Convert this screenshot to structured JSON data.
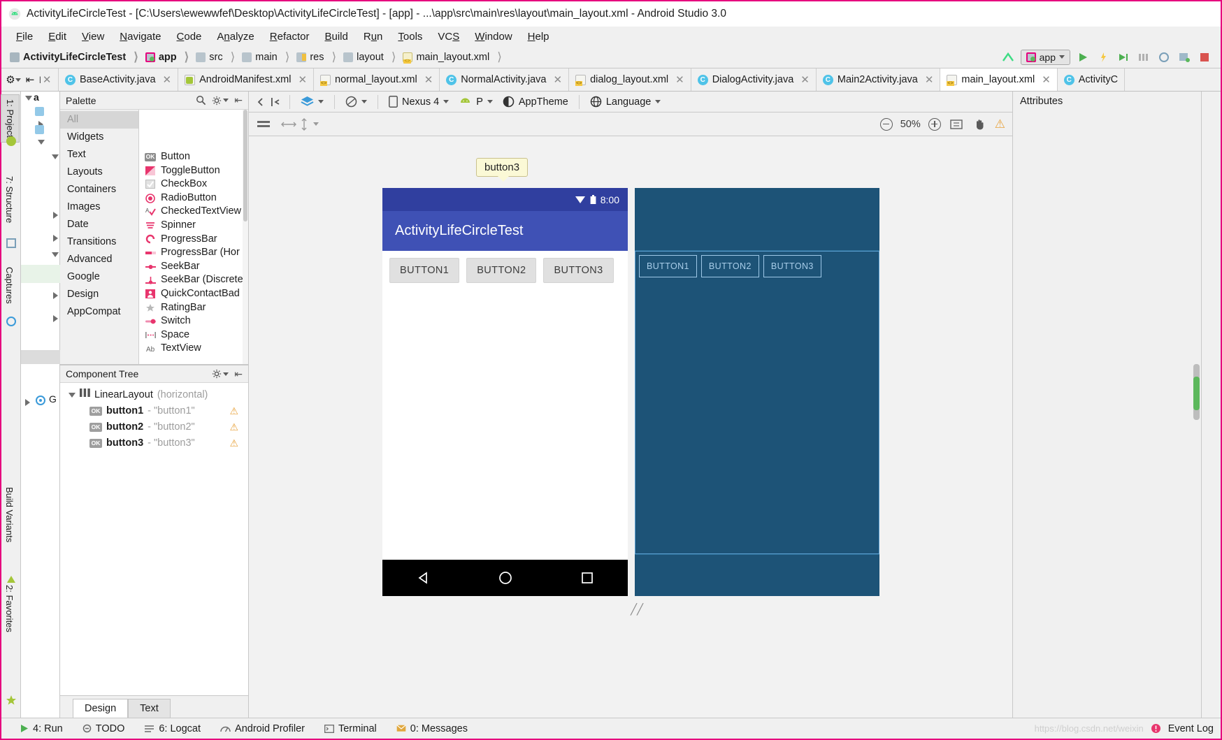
{
  "window": {
    "title": "ActivityLifeCircleTest - [C:\\Users\\ewewwfef\\Desktop\\ActivityLifeCircleTest] - [app] - ...\\app\\src\\main\\res\\layout\\main_layout.xml - Android Studio 3.0",
    "logo_icon": "android-studio-icon"
  },
  "menubar": {
    "items": [
      {
        "label": "File"
      },
      {
        "label": "Edit"
      },
      {
        "label": "View"
      },
      {
        "label": "Navigate"
      },
      {
        "label": "Code"
      },
      {
        "label": "Analyze"
      },
      {
        "label": "Refactor"
      },
      {
        "label": "Build"
      },
      {
        "label": "Run"
      },
      {
        "label": "Tools"
      },
      {
        "label": "VCS"
      },
      {
        "label": "Window"
      },
      {
        "label": "Help"
      }
    ]
  },
  "breadcrumb": {
    "items": [
      {
        "label": "ActivityLifeCircleTest",
        "icon": "project-folder-icon"
      },
      {
        "label": "app",
        "icon": "module-folder-icon"
      },
      {
        "label": "src",
        "icon": "folder-icon"
      },
      {
        "label": "main",
        "icon": "folder-icon"
      },
      {
        "label": "res",
        "icon": "res-folder-icon"
      },
      {
        "label": "layout",
        "icon": "folder-icon"
      },
      {
        "label": "main_layout.xml",
        "icon": "xml-file-icon"
      }
    ],
    "run_config": "app",
    "toolbar_icons": [
      "branch-icon",
      "run-icon",
      "debug-icon",
      "attach-debugger-icon",
      "coverage-icon",
      "profiler-icon",
      "avd-manager-icon",
      "stop-icon"
    ]
  },
  "editor_tabs": [
    {
      "label": "BaseActivity.java",
      "icon": "java-class-icon",
      "active": false
    },
    {
      "label": "AndroidManifest.xml",
      "icon": "manifest-icon",
      "active": false
    },
    {
      "label": "normal_layout.xml",
      "icon": "xml-layout-icon",
      "active": false
    },
    {
      "label": "NormalActivity.java",
      "icon": "java-class-icon",
      "active": false
    },
    {
      "label": "dialog_layout.xml",
      "icon": "xml-layout-icon",
      "active": false
    },
    {
      "label": "DialogActivity.java",
      "icon": "java-class-icon",
      "active": false
    },
    {
      "label": "Main2Activity.java",
      "icon": "java-class-icon",
      "active": false
    },
    {
      "label": "main_layout.xml",
      "icon": "xml-layout-icon",
      "active": true
    },
    {
      "label": "ActivityC",
      "icon": "java-class-icon",
      "active": false
    }
  ],
  "left_rail": [
    {
      "label": "1: Project",
      "icon": "project-icon"
    },
    {
      "label": "7: Structure",
      "icon": "structure-icon"
    },
    {
      "label": "Captures",
      "icon": "captures-icon"
    },
    {
      "label": "Build Variants",
      "icon": "build-variants-icon"
    },
    {
      "label": "2: Favorites",
      "icon": "favorites-icon"
    }
  ],
  "palette": {
    "title": "Palette",
    "search_icon": "search-icon",
    "gear_icon": "gear-icon",
    "collapse_icon": "collapse-icon",
    "categories": [
      {
        "label": "All",
        "selected": true
      },
      {
        "label": "Widgets",
        "selected": false
      },
      {
        "label": "Text",
        "selected": false
      },
      {
        "label": "Layouts",
        "selected": false
      },
      {
        "label": "Containers",
        "selected": false
      },
      {
        "label": "Images",
        "selected": false
      },
      {
        "label": "Date",
        "selected": false
      },
      {
        "label": "Transitions",
        "selected": false
      },
      {
        "label": "Advanced",
        "selected": false
      },
      {
        "label": "Google",
        "selected": false
      },
      {
        "label": "Design",
        "selected": false
      },
      {
        "label": "AppCompat",
        "selected": false
      }
    ],
    "items": [
      {
        "label": "Button",
        "icon": "button-icon"
      },
      {
        "label": "ToggleButton",
        "icon": "toggle-button-icon"
      },
      {
        "label": "CheckBox",
        "icon": "checkbox-icon"
      },
      {
        "label": "RadioButton",
        "icon": "radio-button-icon"
      },
      {
        "label": "CheckedTextView",
        "icon": "checked-text-view-icon"
      },
      {
        "label": "Spinner",
        "icon": "spinner-icon"
      },
      {
        "label": "ProgressBar",
        "icon": "progress-bar-icon"
      },
      {
        "label": "ProgressBar (Hor",
        "icon": "progress-bar-horizontal-icon"
      },
      {
        "label": "SeekBar",
        "icon": "seekbar-icon"
      },
      {
        "label": "SeekBar (Discrete",
        "icon": "seekbar-discrete-icon"
      },
      {
        "label": "QuickContactBad",
        "icon": "quick-contact-badge-icon"
      },
      {
        "label": "RatingBar",
        "icon": "rating-bar-icon"
      },
      {
        "label": "Switch",
        "icon": "switch-icon"
      },
      {
        "label": "Space",
        "icon": "space-icon"
      },
      {
        "label": "TextView",
        "icon": "text-view-icon"
      }
    ]
  },
  "component_tree": {
    "title": "Component Tree",
    "gear_icon": "gear-icon",
    "collapse_icon": "collapse-icon",
    "root": {
      "label": "LinearLayout",
      "meta": "(horizontal)",
      "icon": "linear-layout-icon"
    },
    "children": [
      {
        "label": "button1",
        "value": "- \"button1\"",
        "icon": "button-icon",
        "warning": true
      },
      {
        "label": "button2",
        "value": "- \"button2\"",
        "icon": "button-icon",
        "warning": true
      },
      {
        "label": "button3",
        "value": "- \"button3\"",
        "icon": "button-icon",
        "warning": true
      }
    ]
  },
  "design_toolbar": {
    "back_icon": "back-icon",
    "collapse_icon": "collapse-all-icon",
    "design_mode": "layers-icon",
    "orientation": "rotate-icon",
    "device": "Nexus 4",
    "device_icon": "phone-icon",
    "api": "P",
    "api_icon": "android-icon",
    "theme": "AppTheme",
    "theme_icon": "theme-icon",
    "language": "Language",
    "language_icon": "globe-icon"
  },
  "sub_toolbar": {
    "menu_icon": "hamburger-icon",
    "width_icon": "horizontal-arrows-icon",
    "height_icon": "vertical-arrows-icon",
    "zoom_level": "50%",
    "zoom_out_icon": "zoom-out-icon",
    "zoom_in_icon": "zoom-in-icon",
    "zoom_fit_icon": "zoom-fit-icon",
    "pan_icon": "pan-hand-icon",
    "warning_icon": "warning-icon"
  },
  "canvas": {
    "tooltip": "button3",
    "device_preview": {
      "status_time": "8:00",
      "wifi_icon": "wifi-icon",
      "battery_icon": "battery-icon",
      "app_title": "ActivityLifeCircleTest",
      "buttons": [
        "BUTTON1",
        "BUTTON2",
        "BUTTON3"
      ],
      "nav_buttons": [
        "back-triangle-icon",
        "home-circle-icon",
        "recents-square-icon"
      ]
    },
    "blueprint": {
      "buttons": [
        "BUTTON1",
        "BUTTON2",
        "BUTTON3"
      ],
      "resize_handle": "resize-handle-icon"
    }
  },
  "design_tabs": [
    {
      "label": "Design",
      "selected": true
    },
    {
      "label": "Text",
      "selected": false
    }
  ],
  "attributes_panel": {
    "title": "Attributes"
  },
  "statusbar": {
    "items": [
      {
        "label": "4: Run",
        "icon": "run-icon"
      },
      {
        "label": "TODO",
        "icon": "todo-icon"
      },
      {
        "label": "6: Logcat",
        "icon": "logcat-icon"
      },
      {
        "label": "Android Profiler",
        "icon": "profiler-icon"
      },
      {
        "label": "Terminal",
        "icon": "terminal-icon"
      },
      {
        "label": "0: Messages",
        "icon": "messages-icon"
      }
    ],
    "event_log": "Event Log",
    "event_log_icon": "event-log-icon",
    "watermark": "https://blog.csdn.net/weixin"
  },
  "colors": {
    "accent_pink": "#e6007e",
    "appbar_blue": "#3f51b5",
    "statusbar_blue": "#303f9f",
    "blueprint_blue": "#1d5377",
    "blueprint_line": "#5b9fd0",
    "warning_orange": "#e8a33d"
  }
}
